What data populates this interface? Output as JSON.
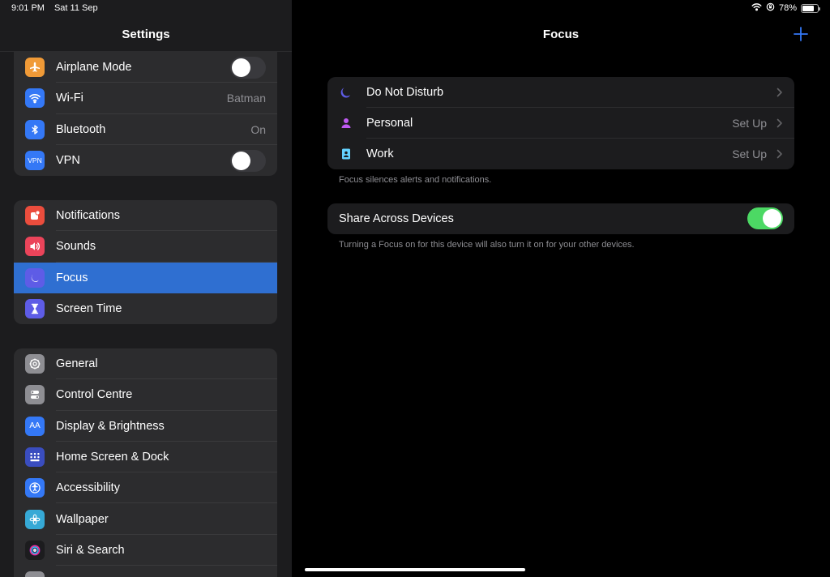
{
  "status": {
    "time": "9:01 PM",
    "date": "Sat 11 Sep",
    "battery": "78%",
    "battery_level": 0.78
  },
  "sidebar": {
    "title": "Settings",
    "group1": [
      {
        "label": "Airplane Mode",
        "icon": "airplane-icon",
        "color": "#f09a37",
        "toggle": false
      },
      {
        "label": "Wi-Fi",
        "icon": "wifi-icon",
        "color": "#3478f6",
        "value": "Batman"
      },
      {
        "label": "Bluetooth",
        "icon": "bluetooth-icon",
        "color": "#3478f6",
        "value": "On"
      },
      {
        "label": "VPN",
        "icon": "vpn-icon",
        "icon_text": "VPN",
        "color": "#3478f6",
        "toggle": false
      }
    ],
    "group2": [
      {
        "label": "Notifications",
        "icon": "notifications-icon",
        "color": "#eb4d3d"
      },
      {
        "label": "Sounds",
        "icon": "sounds-icon",
        "color": "#eb445a"
      },
      {
        "label": "Focus",
        "icon": "moon-icon",
        "color": "#5e5ce6",
        "selected": true
      },
      {
        "label": "Screen Time",
        "icon": "hourglass-icon",
        "color": "#5e5ce6"
      }
    ],
    "group3": [
      {
        "label": "General",
        "icon": "gear-icon",
        "color": "#8e8e93"
      },
      {
        "label": "Control Centre",
        "icon": "control-centre-icon",
        "color": "#8e8e93"
      },
      {
        "label": "Display & Brightness",
        "icon": "display-icon",
        "icon_text": "AA",
        "color": "#3478f6"
      },
      {
        "label": "Home Screen & Dock",
        "icon": "home-screen-icon",
        "color": "#3a4dbf"
      },
      {
        "label": "Accessibility",
        "icon": "accessibility-icon",
        "color": "#3478f6"
      },
      {
        "label": "Wallpaper",
        "icon": "wallpaper-icon",
        "color": "#36a9d6"
      },
      {
        "label": "Siri & Search",
        "icon": "siri-icon",
        "color": "#1c1c1e"
      },
      {
        "label": "",
        "icon": "apple-pencil-icon",
        "color": "#8e8e93"
      }
    ]
  },
  "main": {
    "title": "Focus",
    "focus_items": [
      {
        "label": "Do Not Disturb",
        "icon": "moon-icon",
        "color": "#5e5ce6",
        "value": ""
      },
      {
        "label": "Personal",
        "icon": "person-icon",
        "color": "#bf5af2",
        "value": "Set Up"
      },
      {
        "label": "Work",
        "icon": "work-badge-icon",
        "color": "#64d2ff",
        "value": "Set Up"
      }
    ],
    "focus_note": "Focus silences alerts and notifications.",
    "share": {
      "label": "Share Across Devices",
      "toggle": true
    },
    "share_note": "Turning a Focus on for this device will also turn it on for your other devices.",
    "accent": "#3478f6"
  }
}
